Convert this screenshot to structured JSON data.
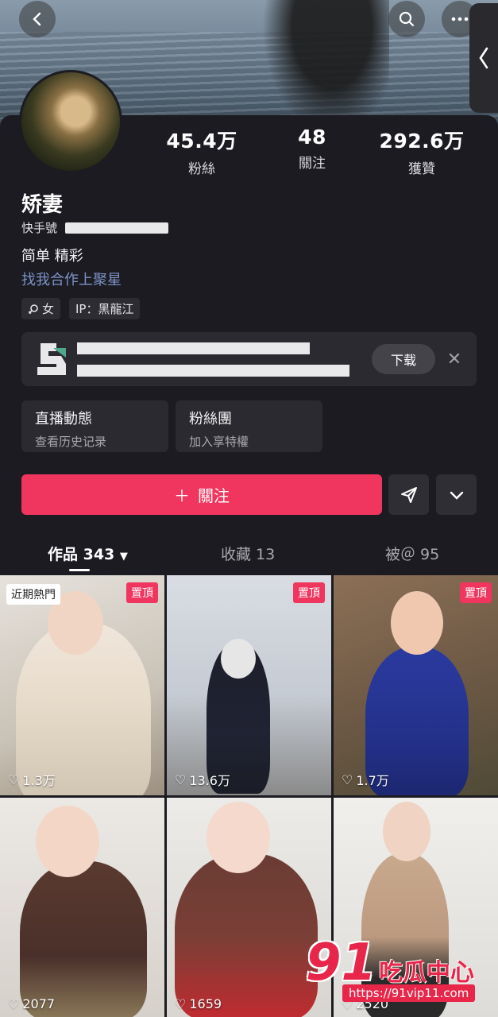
{
  "header": {
    "icons": [
      "back-icon",
      "search-icon",
      "more-icon",
      "chevron-left-icon"
    ]
  },
  "profile": {
    "name": "矫妻",
    "kuaishou_id_label": "快手號",
    "bio_line1": "简单 精彩",
    "bio_line2": "找我合作上聚星",
    "gender_tag": "女",
    "ip_tag": "IP：黑龍江"
  },
  "stats": [
    {
      "value": "45.4万",
      "label": "粉絲"
    },
    {
      "value": "48",
      "label": "關注"
    },
    {
      "value": "292.6万",
      "label": "獲贊"
    }
  ],
  "banner": {
    "download_label": "下载",
    "close_label": "✕"
  },
  "cards": [
    {
      "title": "直播動態",
      "subtitle": "查看历史记录"
    },
    {
      "title": "粉絲團",
      "subtitle": "加入享特權"
    }
  ],
  "actions": {
    "follow_label": "關注",
    "follow_prefix": "＋"
  },
  "tabs": [
    {
      "label": "作品 343"
    },
    {
      "label": "收藏 13"
    },
    {
      "label": "被＠ 95"
    }
  ],
  "videos": [
    {
      "hot": "近期熱門",
      "pinned": "置頂",
      "likes": "1.3万"
    },
    {
      "hot": "",
      "pinned": "置頂",
      "likes": "13.6万"
    },
    {
      "hot": "",
      "pinned": "置頂",
      "likes": "1.7万"
    },
    {
      "hot": "",
      "pinned": "",
      "likes": "2077"
    },
    {
      "hot": "",
      "pinned": "",
      "likes": "1659"
    },
    {
      "hot": "",
      "pinned": "",
      "likes": "2520"
    }
  ],
  "watermark": {
    "number": "91",
    "text": "吃瓜中心",
    "url": "https://91vip11.com"
  },
  "colors": {
    "accent": "#f0355e",
    "background": "#1c1b22",
    "link": "#7d93c7"
  }
}
